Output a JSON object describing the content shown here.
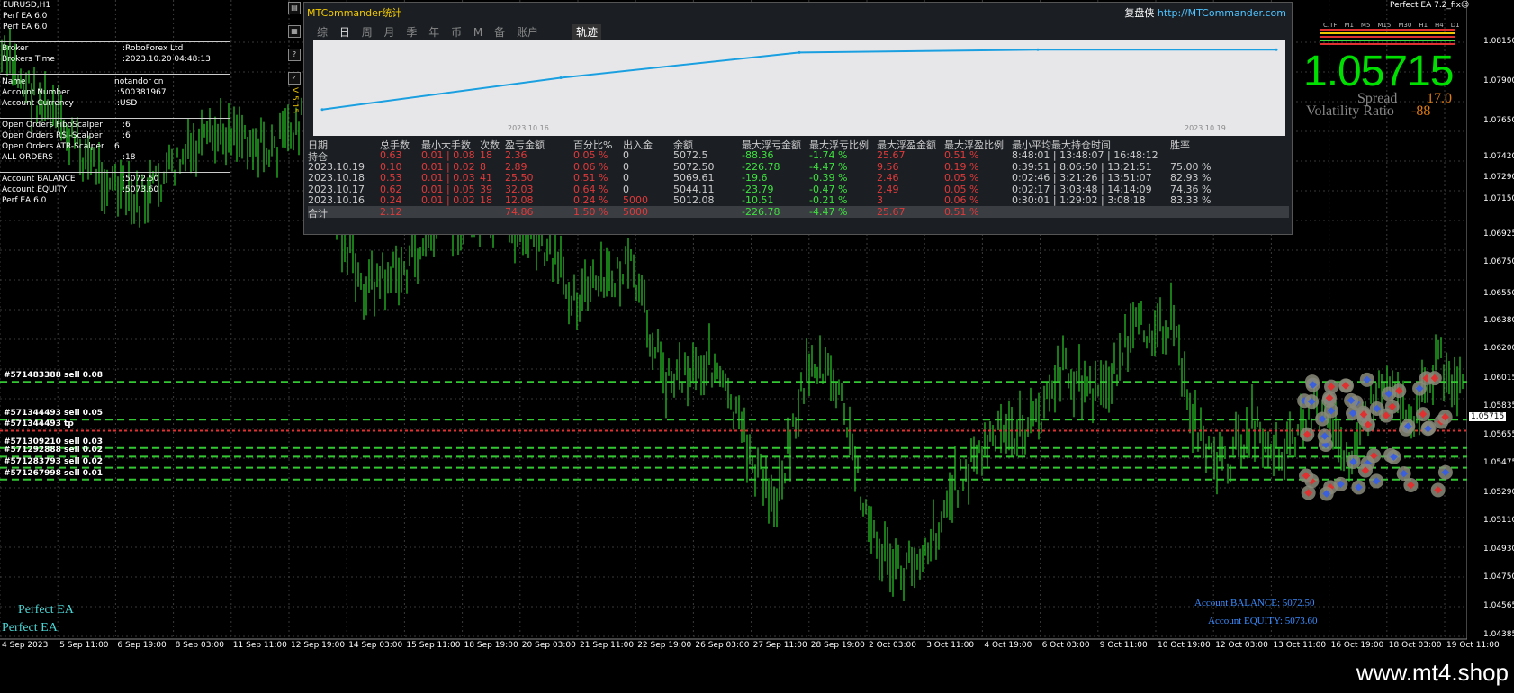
{
  "chart": {
    "symbol_title": "EURUSD,H1",
    "ea_lines": [
      "Perf EA 6.0",
      "Perf EA 6.0"
    ],
    "ea_name_right": "Perfect EA 7.2_fix☺",
    "version_vertical": "V 5.15",
    "colors": {
      "candle": "#22b022",
      "grid": "#3a3a3a",
      "sell_line": "#33c833",
      "tp_line": "#e03030"
    }
  },
  "info_panel": {
    "broker_label": "Broker",
    "broker_value": ":RoboForex Ltd",
    "broker_time_label": "Brokers Time",
    "broker_time_value": ":2023.10.20 04:48:13",
    "name_label": "Name",
    "name_value": ":notandor cn",
    "account_number_label": "Account Number",
    "account_number_value": ":500381967",
    "account_currency_label": "Account Currency",
    "account_currency_value": ":USD",
    "open_fibo_label": "Open Orders FiboScalper",
    "open_fibo_value": ":6",
    "open_rsi_label": "Open Orders RSI-Scalper",
    "open_rsi_value": ":6",
    "open_atr_label": "Open Orders ATR-Scalper",
    "open_atr_value": ":6",
    "all_orders_label": "ALL ORDERS",
    "all_orders_value": ":18",
    "balance_label": "Account BALANCE",
    "balance_value": ":5072.50",
    "equity_label": "Account EQUITY",
    "equity_value": ":5073.60",
    "footer": "Perf EA 6.0"
  },
  "orders": [
    {
      "label": "#571483388 sell 0.08",
      "price": 1.05995
    },
    {
      "label": "#571344493 sell 0.05",
      "price": 1.05755
    },
    {
      "label": "#571344493 tp",
      "price": 1.05685
    },
    {
      "label": "#571309210 sell 0.03",
      "price": 1.05575
    },
    {
      "label": "#571292888 sell 0.02",
      "price": 1.0552
    },
    {
      "label": "#571283793 sell 0.02",
      "price": 1.0545
    },
    {
      "label": "#571267998 sell 0.01",
      "price": 1.05375
    }
  ],
  "mtc": {
    "title": "MTCommander统计",
    "brand": "复盘侠",
    "url": "http://MTCommander.com",
    "tabs": [
      "综",
      "日",
      "周",
      "月",
      "季",
      "年",
      "币",
      "M",
      "备",
      "账户"
    ],
    "track_button": "轨迹",
    "graph_date_start": "2023.10.16",
    "graph_date_end": "2023.10.19",
    "headers": [
      "日期",
      "总手数",
      "最小大手数",
      "次数",
      "盈亏金额",
      "百分比%",
      "出入金",
      "余额",
      "最大浮亏金额",
      "最大浮亏比例",
      "最大浮盈金额",
      "最大浮盈比例",
      "最小平均最大持仓时间",
      "胜率"
    ],
    "rows": [
      [
        "持仓",
        "0.63",
        "0.01 | 0.08",
        "18",
        "2.36",
        "0.05 %",
        "0",
        "5072.5",
        "-88.36",
        "-1.74 %",
        "25.67",
        "0.51 %",
        "8:48:01 | 13:48:07 | 16:48:12",
        ""
      ],
      [
        "2023.10.19",
        "0.10",
        "0.01 | 0.02",
        "8",
        "2.89",
        "0.06 %",
        "0",
        "5072.50",
        "-226.78",
        "-4.47 %",
        "9.56",
        "0.19 %",
        "0:39:51 | 8:06:50 | 13:21:51",
        "75.00 %"
      ],
      [
        "2023.10.18",
        "0.53",
        "0.01 | 0.03",
        "41",
        "25.50",
        "0.51 %",
        "0",
        "5069.61",
        "-19.6",
        "-0.39 %",
        "2.46",
        "0.05 %",
        "0:02:46 | 3:21:26 | 13:51:07",
        "82.93 %"
      ],
      [
        "2023.10.17",
        "0.62",
        "0.01 | 0.05",
        "39",
        "32.03",
        "0.64 %",
        "0",
        "5044.11",
        "-23.79",
        "-0.47 %",
        "2.49",
        "0.05 %",
        "0:02:17 | 3:03:48 | 14:14:09",
        "74.36 %"
      ],
      [
        "2023.10.16",
        "0.24",
        "0.01 | 0.02",
        "18",
        "12.08",
        "0.24 %",
        "5000",
        "5012.08",
        "-10.51",
        "-0.21 %",
        "3",
        "0.06 %",
        "0:30:01 | 1:29:02 | 3:08:18",
        "83.33 %"
      ],
      [
        "合计",
        "2.12",
        "",
        "",
        "74.86",
        "1.50 %",
        "5000",
        "",
        "-226.78",
        "-4.47 %",
        "25.67",
        "0.51 %",
        "",
        ""
      ]
    ]
  },
  "right_panel": {
    "bid": "1.05715",
    "spread_label": "Spread",
    "spread_value": "17.0",
    "volatility_label": "Volatility Ratio",
    "volatility_value": "-88",
    "timeframes": [
      "C.TF",
      "M1",
      "M5",
      "M15",
      "M30",
      "H1",
      "H4",
      "D1"
    ],
    "account_balance": "Account BALANCE: 5072.50",
    "account_equity": "Account EQUITY: 5073.60"
  },
  "bottom_left": {
    "perfect1": "Perfect EA",
    "perfect2": "Perfect EA"
  },
  "price_axis": {
    "ticks": [
      "1.08150",
      "1.07900",
      "1.07650",
      "1.07420",
      "1.07290",
      "1.07150",
      "1.06925",
      "1.06750",
      "1.06550",
      "1.06380",
      "1.06200",
      "1.06015",
      "1.05835",
      "1.05655",
      "1.05475",
      "1.05290",
      "1.05110",
      "1.04930",
      "1.04750",
      "1.04565",
      "1.04385"
    ],
    "current": "1.05715"
  },
  "time_axis": [
    "4 Sep 2023",
    "5 Sep 11:00",
    "6 Sep 19:00",
    "8 Sep 03:00",
    "11 Sep 11:00",
    "12 Sep 19:00",
    "14 Sep 03:00",
    "15 Sep 11:00",
    "18 Sep 19:00",
    "20 Sep 03:00",
    "21 Sep 11:00",
    "22 Sep 19:00",
    "26 Sep 03:00",
    "27 Sep 11:00",
    "28 Sep 19:00",
    "2 Oct 03:00",
    "3 Oct 11:00",
    "4 Oct 19:00",
    "6 Oct 03:00",
    "9 Oct 11:00",
    "10 Oct 19:00",
    "12 Oct 03:00",
    "13 Oct 11:00",
    "16 Oct 19:00",
    "18 Oct 03:00",
    "19 Oct 11:00"
  ],
  "footer": {
    "watermark": "www.mt4.shop"
  },
  "chart_data": {
    "type": "line",
    "title": "",
    "x": [
      "2023.10.16",
      "2023.10.17",
      "2023.10.18",
      "2023.10.19",
      "持仓"
    ],
    "series": [
      {
        "name": "",
        "values": [
          5012.08,
          5044.11,
          5069.61,
          5072.5,
          5072.5
        ]
      }
    ],
    "xlabel": "",
    "ylabel": ""
  }
}
